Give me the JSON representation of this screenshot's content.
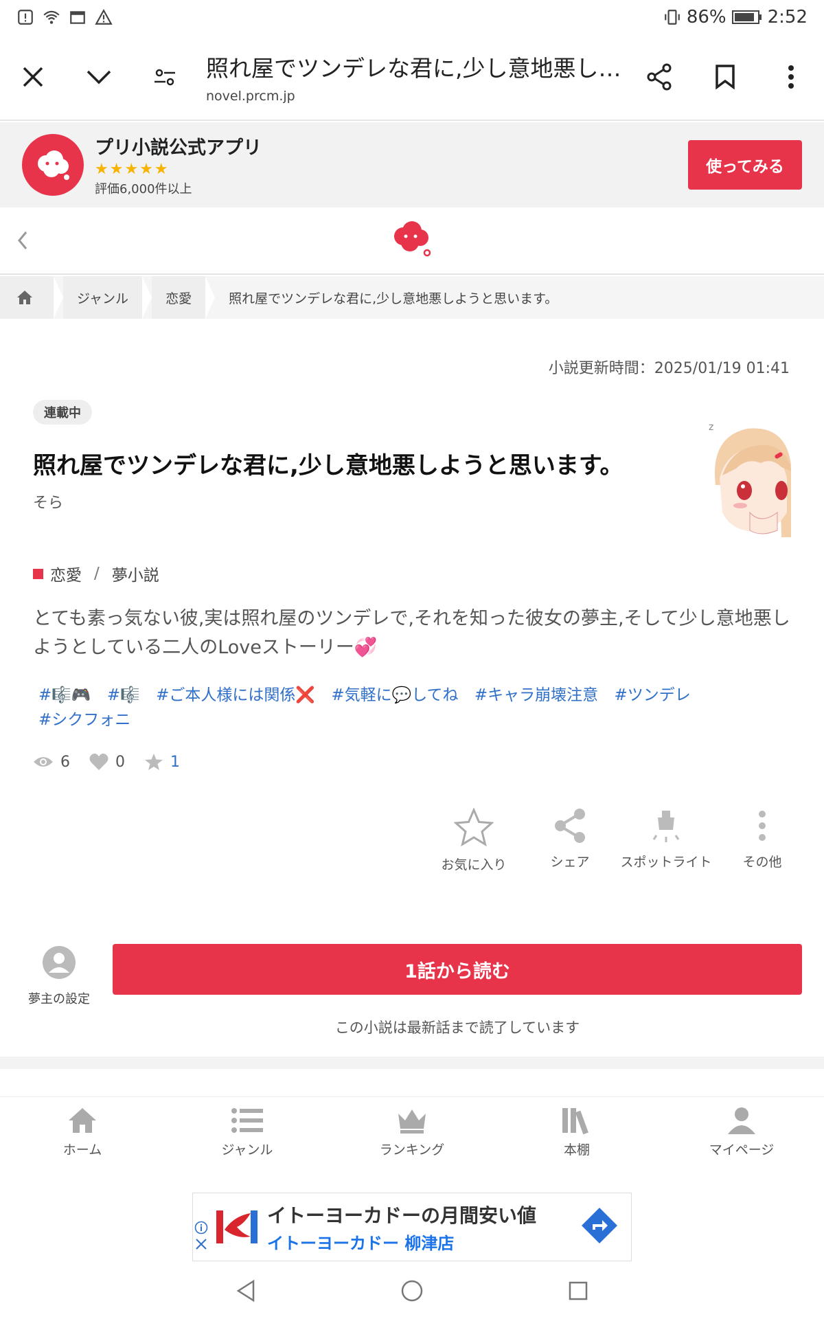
{
  "status_bar": {
    "battery": "86%",
    "time": "2:52"
  },
  "browser": {
    "page_title": "照れ屋でツンデレな君に,少し意地悪しようと思います。",
    "host": "novel.prcm.jp"
  },
  "app_banner": {
    "name": "プリ小説公式アプリ",
    "stars": "★★★★★",
    "reviews": "評価6,000件以上",
    "cta": "使ってみる"
  },
  "breadcrumb": {
    "items": [
      "ジャンル",
      "恋愛",
      "照れ屋でツンデレな君に,少し意地悪しようと思います。"
    ]
  },
  "novel": {
    "updated": "小説更新時間：2025/01/19 01:41",
    "status": "連載中",
    "title": "照れ屋でツンデレな君に,少し意地悪しようと思います。",
    "author": "そら",
    "genre": "恋愛",
    "subgenre": "夢小説",
    "summary": "とても素っ気ない彼,実は照れ屋のツンデレで,それを知った彼女の夢主,そして少し意地悪しようとしている二人のLoveストーリー💞",
    "tags": [
      "#🎼🎮",
      "#🎼",
      "#ご本人様には関係❌",
      "#気軽に💬してね",
      "#キャラ崩壊注意",
      "#ツンデレ",
      "#シクフォニ"
    ],
    "views": "6",
    "likes": "0",
    "favorites": "1"
  },
  "actions": {
    "favorite": "お気に入り",
    "share": "シェア",
    "spotlight": "スポットライト",
    "more": "その他"
  },
  "reader": {
    "profile_setting": "夢主の設定",
    "read_button": "1話から読む",
    "note": "この小説は最新話まで読了しています"
  },
  "bottom_nav": {
    "home": "ホーム",
    "genre": "ジャンル",
    "ranking": "ランキング",
    "bookshelf": "本棚",
    "mypage": "マイページ"
  },
  "ad": {
    "title": "イトーヨーカドーの月間安い値",
    "subtitle": "イトーヨーカドー 柳津店"
  },
  "colors": {
    "accent": "#e8344a",
    "link": "#3070c8"
  }
}
